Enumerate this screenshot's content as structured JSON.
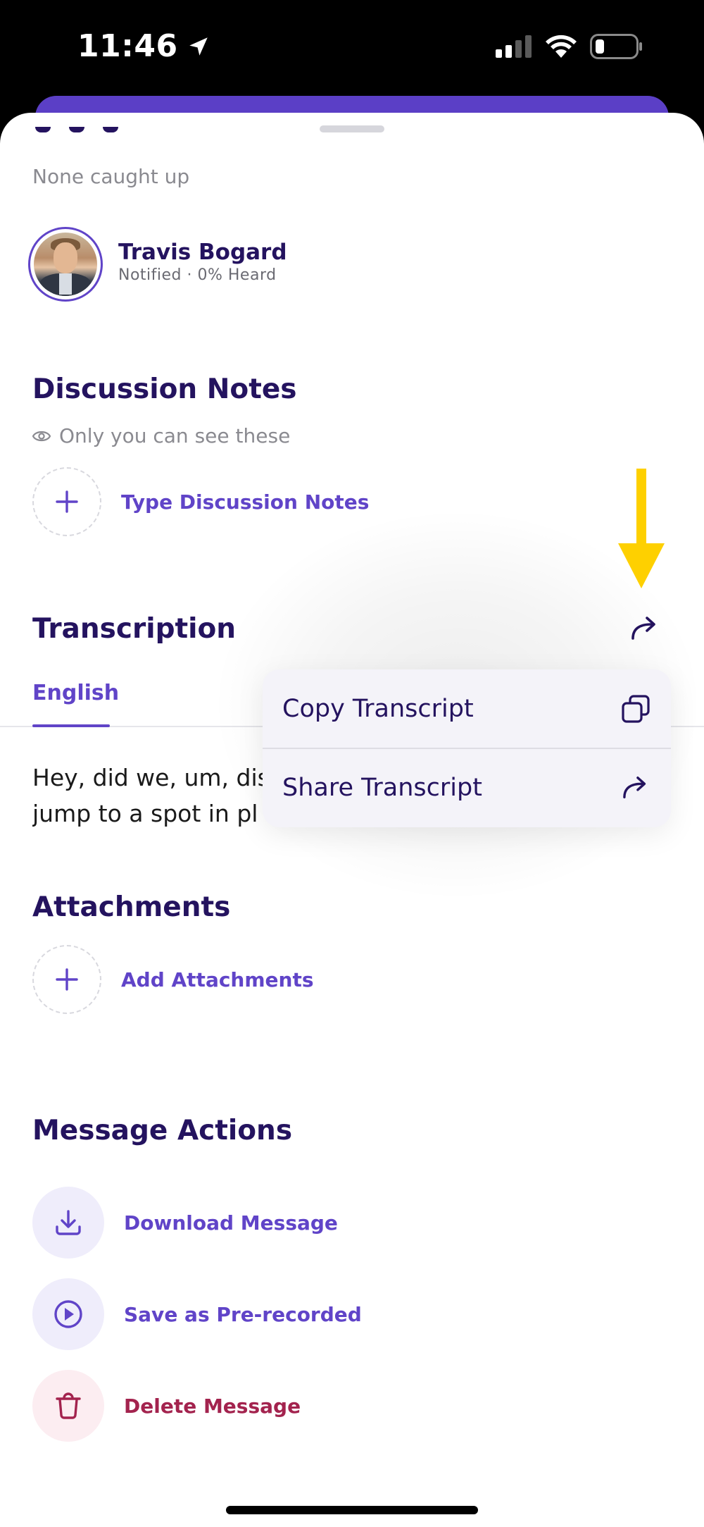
{
  "status_bar": {
    "time": "11:46",
    "icons": [
      "location-arrow-icon",
      "cellular-signal-icon",
      "wifi-icon",
      "battery-icon"
    ]
  },
  "colors": {
    "accent": "#6044c8",
    "title": "#24135f",
    "danger": "#a3234e",
    "annotation_arrow": "#fed000"
  },
  "listeners": {
    "caught_up_text": "None caught up",
    "people": [
      {
        "name": "Travis Bogard",
        "status": "Notified · 0% Heard"
      }
    ]
  },
  "discussion_notes": {
    "title": "Discussion Notes",
    "privacy_text": "Only you can see these",
    "add_label": "Type Discussion Notes"
  },
  "transcription": {
    "title": "Transcription",
    "tabs": [
      "English"
    ],
    "text_line1": "Hey, did we, um, dis",
    "text_line2": "jump to a spot in pl"
  },
  "transcript_menu": {
    "items": [
      {
        "label": "Copy Transcript",
        "icon": "copy-icon"
      },
      {
        "label": "Share Transcript",
        "icon": "share-arrow-icon"
      }
    ]
  },
  "attachments": {
    "title": "Attachments",
    "add_label": "Add Attachments"
  },
  "message_actions": {
    "title": "Message Actions",
    "items": [
      {
        "label": "Download Message",
        "icon": "download-icon"
      },
      {
        "label": "Save as Pre-recorded",
        "icon": "play-circle-icon"
      },
      {
        "label": "Delete Message",
        "icon": "trash-icon"
      }
    ]
  }
}
